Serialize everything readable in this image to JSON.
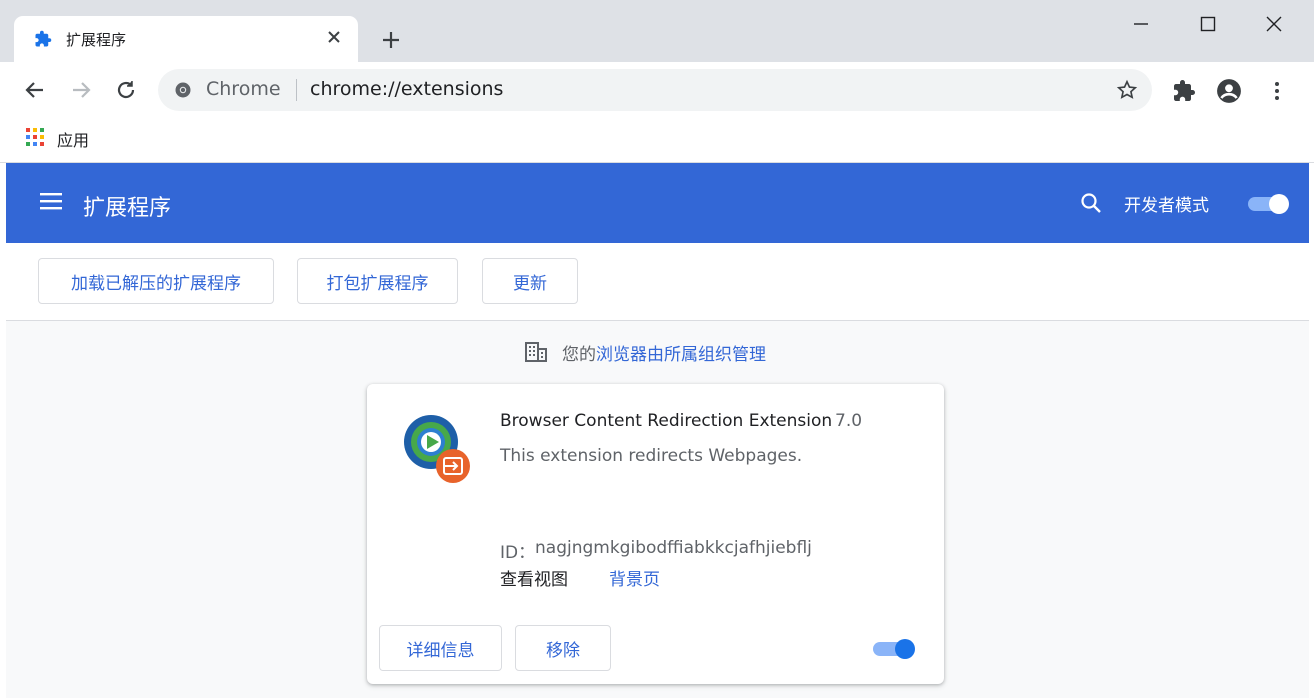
{
  "tab": {
    "title": "扩展程序",
    "icon": "puzzle-piece-icon"
  },
  "window": {
    "minimize": "minimize-icon",
    "maximize": "maximize-icon",
    "close": "close-icon"
  },
  "omnibox": {
    "site_label": "Chrome",
    "url": "chrome://extensions"
  },
  "bookmarks": {
    "apps_label": "应用"
  },
  "header": {
    "title": "扩展程序",
    "dev_mode_label": "开发者模式",
    "dev_mode_enabled": true
  },
  "actions": {
    "load_unpacked": "加载已解压的扩展程序",
    "pack": "打包扩展程序",
    "update": "更新"
  },
  "managed": {
    "prefix": "您的",
    "link": "浏览器由所属组织管理"
  },
  "extension": {
    "name": "Browser Content Redirection Extension",
    "version": "7.0",
    "description": "This extension redirects Webpages.",
    "id_label": "ID：",
    "id_value": "nagjngmkgibodffiabkkcjafhjiebflj",
    "views_label": "查看视图",
    "views_link": "背景页",
    "details_button": "详细信息",
    "remove_button": "移除",
    "enabled": true
  },
  "colors": {
    "accent": "#3367d6",
    "toggle_on": "#1a73e8",
    "toggle_track": "#8ab4f8",
    "logo_orange": "#e8632b",
    "logo_blue": "#1e5fa8",
    "logo_green": "#47a84a"
  }
}
